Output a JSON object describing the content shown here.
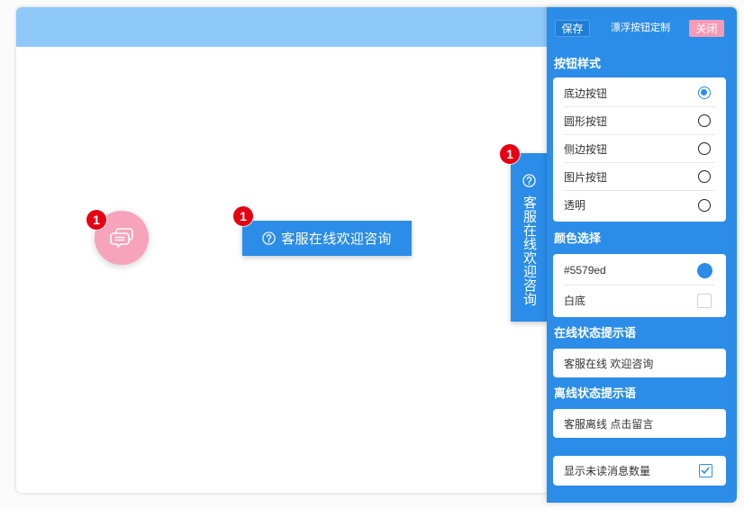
{
  "colors": {
    "panel": "#2b8de8",
    "accent": "#2b8de8",
    "top-bar": "#8fc9f9",
    "save-button": "#1f7fd8",
    "close-button": "#f59bb5",
    "circle-button": "#f7a3bb",
    "badge": "#e60012"
  },
  "preview": {
    "circle_button": {
      "icon": "chat-icon",
      "badge": "1"
    },
    "bottom_button": {
      "icon": "question-icon",
      "label": "客服在线欢迎咨询",
      "badge": "1"
    },
    "side_button": {
      "icon": "question-icon",
      "label": "客服在线欢迎咨询",
      "badge": "1"
    }
  },
  "panel": {
    "save_label": "保存",
    "title": "漂浮按钮定制",
    "close_label": "关闭",
    "button_style": {
      "label": "按钮样式",
      "options": [
        {
          "label": "底边按钮",
          "selected": true
        },
        {
          "label": "圆形按钮",
          "selected": false
        },
        {
          "label": "侧边按钮",
          "selected": false
        },
        {
          "label": "图片按钮",
          "selected": false
        },
        {
          "label": "透明",
          "selected": false
        }
      ]
    },
    "color": {
      "label": "颜色选择",
      "primary": {
        "label": "#5579ed"
      },
      "white_bg": {
        "label": "白底",
        "checked": false
      }
    },
    "online_tip": {
      "label": "在线状态提示语",
      "value": "客服在线 欢迎咨询"
    },
    "offline_tip": {
      "label": "离线状态提示语",
      "value": "客服离线 点击留言"
    },
    "unread_count": {
      "label": "显示未读消息数量",
      "checked": true
    }
  }
}
